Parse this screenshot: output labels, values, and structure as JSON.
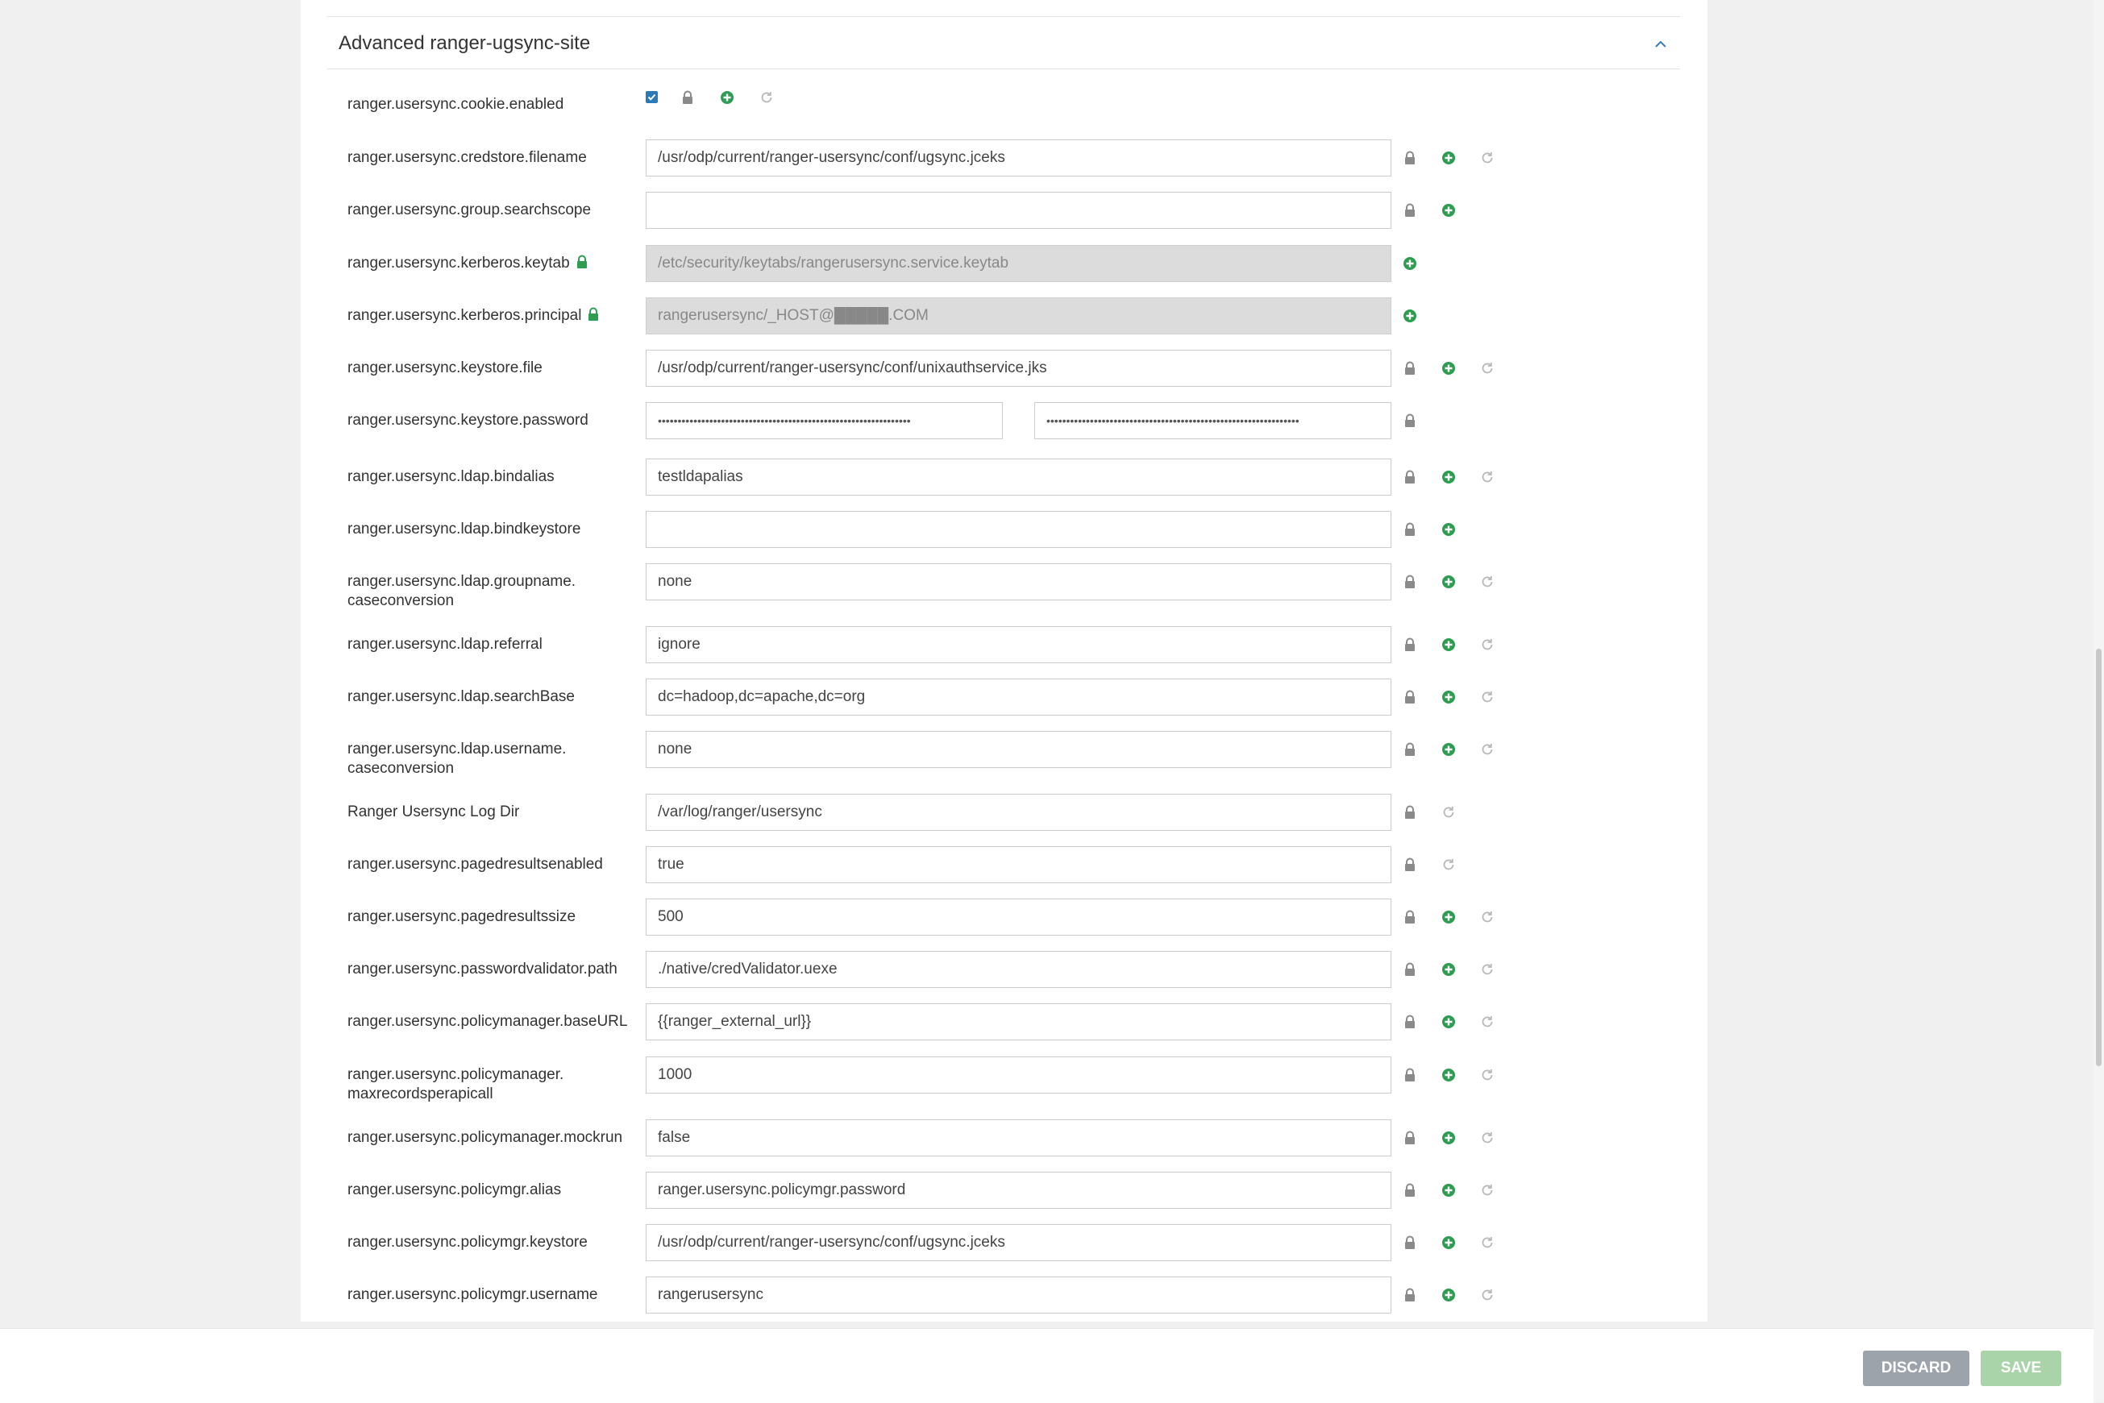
{
  "section": {
    "title": "Advanced ranger-ugsync-site"
  },
  "footer": {
    "discard_label": "DISCARD",
    "save_label": "SAVE"
  },
  "colors": {
    "accent_green": "#2e9d52",
    "lock_gray": "#8a8a8a",
    "checkbox_blue": "#2a7ab8",
    "save_button": "#a9d4a9",
    "discard_button": "#9da3ab"
  },
  "properties": [
    {
      "label": "ranger.usersync.cookie.enabled",
      "type": "checkbox",
      "checked": true,
      "actions": [
        "lock",
        "add",
        "reset"
      ]
    },
    {
      "label": "ranger.usersync.credstore.filename",
      "value": "/usr/odp/current/ranger-usersync/conf/ugsync.jceks",
      "actions": [
        "lock",
        "add",
        "reset"
      ]
    },
    {
      "label": "ranger.usersync.group.searchscope",
      "value": "",
      "actions": [
        "lock",
        "add"
      ]
    },
    {
      "label": "ranger.usersync.kerberos.keytab",
      "locked_label": true,
      "disabled": true,
      "value": "/etc/security/keytabs/rangerusersync.service.keytab",
      "actions": [
        "add"
      ]
    },
    {
      "label": "ranger.usersync.kerberos.principal",
      "locked_label": true,
      "disabled": true,
      "value": "rangerusersync/_HOST@█████.COM",
      "actions": [
        "add"
      ]
    },
    {
      "label": "ranger.usersync.keystore.file",
      "value": "/usr/odp/current/ranger-usersync/conf/unixauthservice.jks",
      "actions": [
        "lock",
        "add",
        "reset"
      ]
    },
    {
      "label": "ranger.usersync.keystore.password",
      "type": "password",
      "value": "••••••••••••••••••••••••••••••••••••••••••••••••••••••••••••••••",
      "confirm_value": "••••••••••••••••••••••••••••••••••••••••••••••••••••••••••••••••",
      "actions": [
        "lock"
      ]
    },
    {
      "label": "ranger.usersync.ldap.bindalias",
      "value": "testldapalias",
      "actions": [
        "lock",
        "add",
        "reset"
      ]
    },
    {
      "label": "ranger.usersync.ldap.bindkeystore",
      "value": "",
      "actions": [
        "lock",
        "add"
      ]
    },
    {
      "label": "ranger.usersync.ldap.groupname.",
      "label2": "caseconversion",
      "value": "none",
      "actions": [
        "lock",
        "add",
        "reset"
      ]
    },
    {
      "label": "ranger.usersync.ldap.referral",
      "value": "ignore",
      "actions": [
        "lock",
        "add",
        "reset"
      ]
    },
    {
      "label": "ranger.usersync.ldap.searchBase",
      "value": "dc=hadoop,dc=apache,dc=org",
      "actions": [
        "lock",
        "add",
        "reset"
      ]
    },
    {
      "label": "ranger.usersync.ldap.username.",
      "label2": "caseconversion",
      "value": "none",
      "actions": [
        "lock",
        "add",
        "reset"
      ]
    },
    {
      "label": "Ranger Usersync Log Dir",
      "value": "/var/log/ranger/usersync",
      "actions": [
        "lock",
        "reset"
      ]
    },
    {
      "label": "ranger.usersync.pagedresultsenabled",
      "value": "true",
      "actions": [
        "lock",
        "reset"
      ]
    },
    {
      "label": "ranger.usersync.pagedresultssize",
      "value": "500",
      "actions": [
        "lock",
        "add",
        "reset"
      ]
    },
    {
      "label": "ranger.usersync.passwordvalidator.path",
      "value": "./native/credValidator.uexe",
      "actions": [
        "lock",
        "add",
        "reset"
      ]
    },
    {
      "label": "ranger.usersync.policymanager.baseURL",
      "value": "{{ranger_external_url}}",
      "actions": [
        "lock",
        "add",
        "reset"
      ]
    },
    {
      "label": "ranger.usersync.policymanager.",
      "label2": "maxrecordsperapicall",
      "value": "1000",
      "actions": [
        "lock",
        "add",
        "reset"
      ]
    },
    {
      "label": "ranger.usersync.policymanager.mockrun",
      "value": "false",
      "actions": [
        "lock",
        "add",
        "reset"
      ]
    },
    {
      "label": "ranger.usersync.policymgr.alias",
      "value": "ranger.usersync.policymgr.password",
      "actions": [
        "lock",
        "add",
        "reset"
      ]
    },
    {
      "label": "ranger.usersync.policymgr.keystore",
      "value": "/usr/odp/current/ranger-usersync/conf/ugsync.jceks",
      "actions": [
        "lock",
        "add",
        "reset"
      ]
    },
    {
      "label": "ranger.usersync.policymgr.username",
      "value": "rangerusersync",
      "actions": [
        "lock",
        "add",
        "reset"
      ]
    }
  ]
}
